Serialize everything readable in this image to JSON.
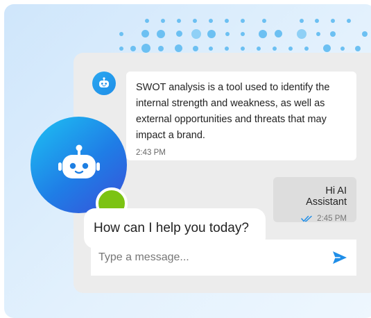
{
  "bot_message": {
    "text": "SWOT analysis is a tool used to identify the internal strength and weakness, as well as external opportunities and threats that may impact a brand.",
    "time": "2:43 PM",
    "avatar_icon": "robot-icon"
  },
  "user_message": {
    "text": "Hi AI Assistant",
    "time": "2:45 PM",
    "read_icon": "double-check-icon"
  },
  "assistant": {
    "prompt": "How can I help you today?",
    "avatar_icon": "robot-icon",
    "status_color": "#7cc313"
  },
  "composer": {
    "placeholder": "Type a message...",
    "send_icon": "send-icon"
  },
  "colors": {
    "accent": "#1f8ee8",
    "card_bg": "#ececec",
    "user_bubble": "#dddddd"
  }
}
